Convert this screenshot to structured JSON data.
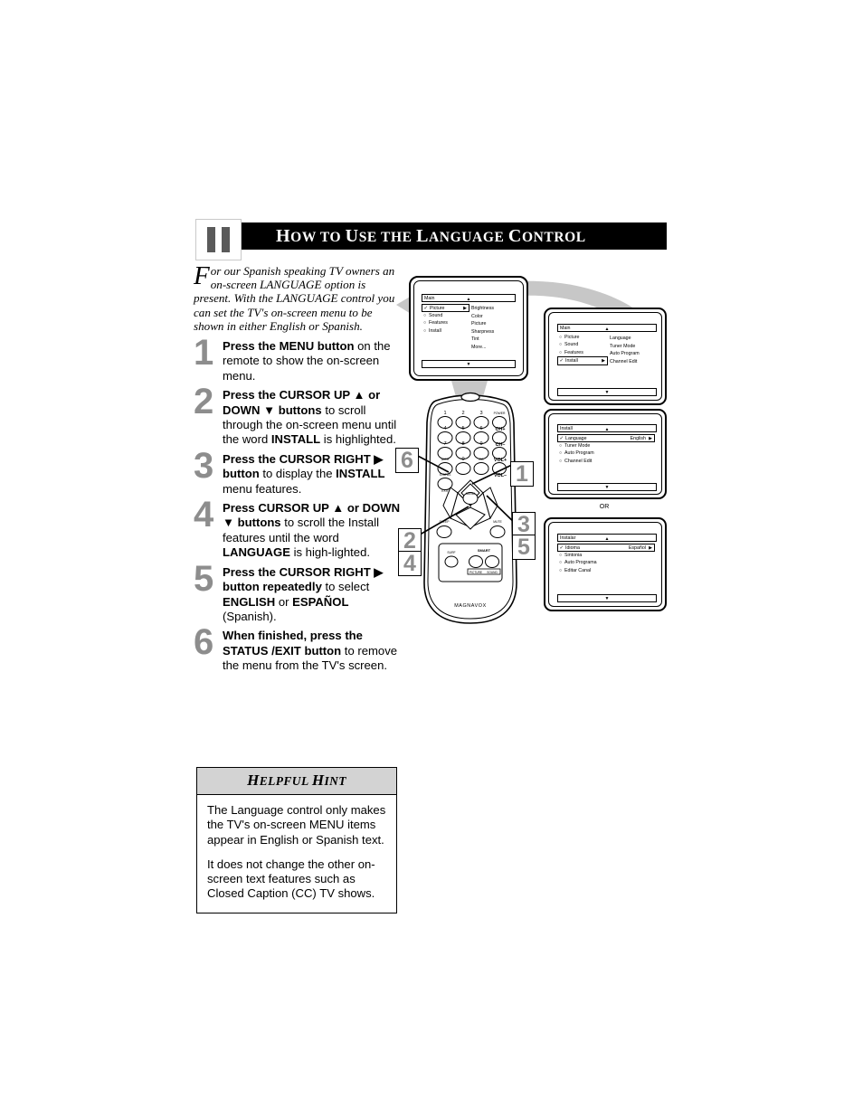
{
  "header": {
    "chapter": "11",
    "title_parts": [
      "H",
      "OW TO ",
      "U",
      "SE THE ",
      "L",
      "ANGUAGE ",
      "C",
      "ONTROL"
    ],
    "title": "How to Use the Language Control"
  },
  "intro": {
    "dropcap": "F",
    "text": "or our Spanish speaking TV owners an on-screen LANGUAGE option is present. With the LANGUAGE control you can set the TV's on-screen menu to be shown in either English or Spanish."
  },
  "steps": [
    {
      "num": "1",
      "html": "<b>Press the MENU button</b> on the remote to show the on-screen menu."
    },
    {
      "num": "2",
      "html": "<b>Press the CURSOR UP ▲ or DOWN ▼ buttons</b> to scroll through the on-screen menu until the word <b>INSTALL</b> is highlighted."
    },
    {
      "num": "3",
      "html": "<b>Press the CURSOR RIGHT ▶ button</b> to display the <b>INSTALL</b> menu features."
    },
    {
      "num": "4",
      "html": "<b>Press CURSOR UP ▲ or DOWN ▼ buttons</b> to scroll the Install features until the word <b>LANGUAGE</b> is high-lighted."
    },
    {
      "num": "5",
      "html": "<b>Press the CURSOR RIGHT ▶ button repeatedly</b> to select <b>ENGLISH</b> or <b>ESPAÑOL</b> (Spanish)."
    },
    {
      "num": "6",
      "html": "<b>When finished, press the STATUS /EXIT button</b> to remove the menu from the TV's screen."
    }
  ],
  "hint": {
    "title": "Helpful Hint",
    "title_parts": [
      "H",
      "ELPFUL ",
      "H",
      "INT"
    ],
    "paragraphs": [
      "The Language control only makes the TV's on-screen MENU items appear in English or Spanish text.",
      "It does not change the other on-screen text features such as Closed Caption (CC) TV shows."
    ]
  },
  "menus": {
    "menu1": {
      "title": "Main",
      "up_arrow": "▲",
      "down_arrow": "▼",
      "rows": [
        {
          "label": "Picture",
          "marker": "check",
          "selected": true,
          "arrow": "▶"
        },
        {
          "label": "Sound",
          "marker": "bullet",
          "selected": false
        },
        {
          "label": "Features",
          "marker": "bullet",
          "selected": false
        },
        {
          "label": "Install",
          "marker": "bullet",
          "selected": false
        }
      ],
      "col2": [
        "Brightness",
        "Color",
        "Picture",
        "Sharpness",
        "Tint",
        "More..."
      ]
    },
    "menu2": {
      "title": "Main",
      "up_arrow": "▲",
      "down_arrow": "▼",
      "rows": [
        {
          "label": "Picture",
          "marker": "bullet",
          "selected": false
        },
        {
          "label": "Sound",
          "marker": "bullet",
          "selected": false
        },
        {
          "label": "Features",
          "marker": "bullet",
          "selected": false
        },
        {
          "label": "Install",
          "marker": "check",
          "selected": true,
          "arrow": "▶"
        }
      ],
      "col2": [
        "Language",
        "Tuner Mode",
        "Auto Program",
        "Channel Edit"
      ]
    },
    "menu3": {
      "title": "Install",
      "up_arrow": "▲",
      "down_arrow": "▼",
      "rows": [
        {
          "label": "Language",
          "marker": "check",
          "selected": true,
          "value": "English",
          "arrow": "▶"
        },
        {
          "label": "Tuner Mode",
          "marker": "bullet",
          "selected": false
        },
        {
          "label": "Auto Program",
          "marker": "bullet",
          "selected": false
        },
        {
          "label": "Channel Edit",
          "marker": "bullet",
          "selected": false
        }
      ],
      "col2": []
    },
    "menu4": {
      "title": "Instalar",
      "up_arrow": "▲",
      "down_arrow": "▼",
      "rows": [
        {
          "label": "Idioma",
          "marker": "check",
          "selected": true,
          "value": "Español",
          "arrow": "▶"
        },
        {
          "label": "Sintonia",
          "marker": "bullet",
          "selected": false
        },
        {
          "label": "Auto Programa",
          "marker": "bullet",
          "selected": false
        },
        {
          "label": "Editar Canal",
          "marker": "bullet",
          "selected": false
        }
      ],
      "col2": []
    },
    "or_label": "OR"
  },
  "remote": {
    "brand": "MAGNAVOX",
    "keypad": [
      "1",
      "2",
      "3",
      "4",
      "5",
      "6",
      "7",
      "8",
      "9",
      "0"
    ],
    "keypad_extra": [
      "A/CH",
      "CC"
    ],
    "side_keys": [
      "POWER",
      "CH+",
      "CH–",
      "VOL+",
      "VOL–"
    ],
    "status_exit": [
      "STATUS",
      "EXIT"
    ],
    "menu_key": "MENU",
    "sleep_key": "SLEEP",
    "mute_key": "MUTE",
    "surf_key": "SURF",
    "smart_label": "SMART",
    "smart_keys": [
      "PICTURE",
      "SOUND"
    ]
  },
  "callouts": [
    {
      "id": "callout-6",
      "label": "6"
    },
    {
      "id": "callout-1",
      "label": "1"
    },
    {
      "id": "callout-2",
      "label": "2"
    },
    {
      "id": "callout-4",
      "label": "4"
    },
    {
      "id": "callout-3",
      "label": "3"
    },
    {
      "id": "callout-5",
      "label": "5"
    }
  ],
  "colors": {
    "header_bg": "#000000",
    "step_number": "#8d8d8d",
    "hint_header_bg": "#d3d3d3",
    "swoosh": "#c7c7c7"
  }
}
